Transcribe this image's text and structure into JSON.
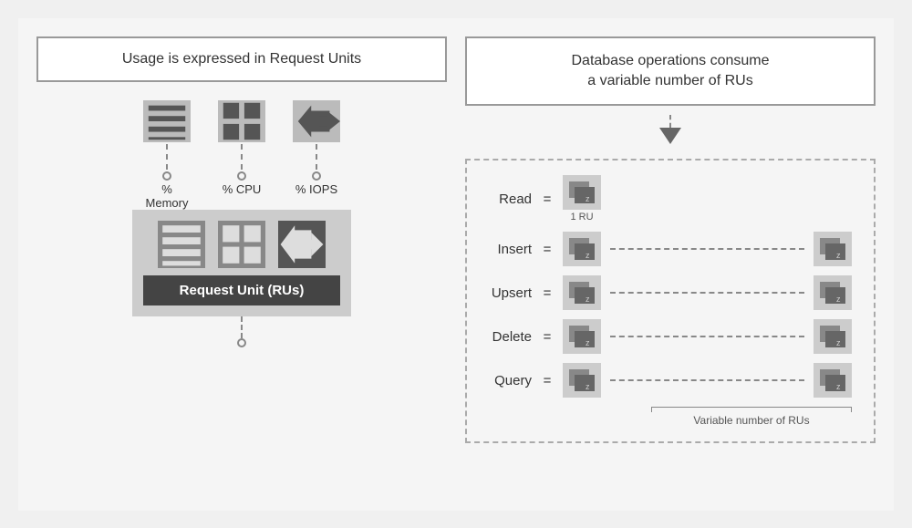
{
  "left": {
    "header": "Usage is expressed in Request Units",
    "resources": [
      {
        "label": "% Memory",
        "icon": "memory-icon"
      },
      {
        "label": "% CPU",
        "icon": "cpu-icon"
      },
      {
        "label": "% IOPS",
        "icon": "iops-icon"
      }
    ],
    "ru_label": "Request Unit (RUs)"
  },
  "right": {
    "header_line1": "Database operations consume",
    "header_line2": "a variable number of RUs",
    "operations": [
      {
        "label": "Read",
        "equals": "=",
        "has_end_icon": false,
        "ru_label": "1 RU"
      },
      {
        "label": "Insert",
        "equals": "=",
        "has_end_icon": true
      },
      {
        "label": "Upsert",
        "equals": "=",
        "has_end_icon": true
      },
      {
        "label": "Delete",
        "equals": "=",
        "has_end_icon": true
      },
      {
        "label": "Query",
        "equals": "=",
        "has_end_icon": true,
        "long_dash": true
      }
    ],
    "variable_label": "Variable number of RUs"
  }
}
